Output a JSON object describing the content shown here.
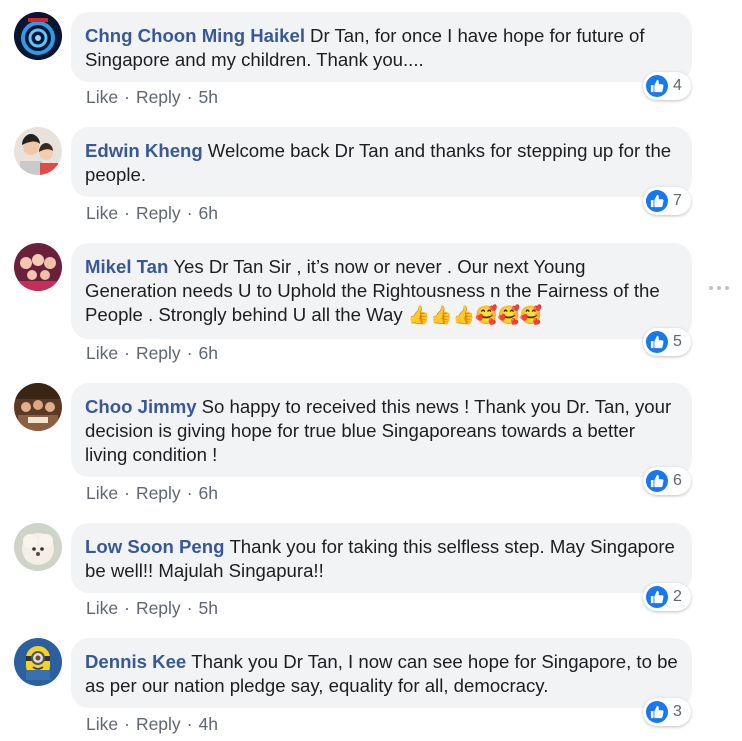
{
  "comments": [
    {
      "author": "Chng Choon Ming Haikel",
      "text": "Dr Tan, for once I have hope for future of Singapore and my children. Thank you....",
      "like": "Like",
      "reply": "Reply",
      "time": "5h",
      "reactions": "4"
    },
    {
      "author": "Edwin Kheng",
      "text": "Welcome back Dr Tan and thanks for stepping up for the people.",
      "like": "Like",
      "reply": "Reply",
      "time": "6h",
      "reactions": "7"
    },
    {
      "author": "Mikel Tan",
      "text": "Yes Dr Tan Sir , it’s now or never . Our next Young Generation needs U to Uphold the Rightousness n the Fairness of the People . Strongly behind U all the Way",
      "emojis": "👍👍👍🥰🥰🥰",
      "like": "Like",
      "reply": "Reply",
      "time": "6h",
      "reactions": "5"
    },
    {
      "author": "Choo Jimmy",
      "text": "So happy to received this news ! Thank you Dr. Tan, your decision is giving hope for true blue Singaporeans towards a better living condition !",
      "like": "Like",
      "reply": "Reply",
      "time": "6h",
      "reactions": "6"
    },
    {
      "author": "Low Soon Peng",
      "text": "Thank you for taking this selfless step. May Singapore be well!! Majulah Singapura!!",
      "like": "Like",
      "reply": "Reply",
      "time": "5h",
      "reactions": "2"
    },
    {
      "author": "Dennis Kee",
      "text": "Thank you Dr Tan, I now can see hope for Singapore, to be as per our nation pledge say, equality for all, democracy.",
      "like": "Like",
      "reply": "Reply",
      "time": "4h",
      "reactions": "3"
    }
  ],
  "separator": "·",
  "icons": {
    "reaction": "like-thumb-icon",
    "options": "more-options-icon"
  },
  "colors": {
    "author": "#385898",
    "like_badge": "#1877f2",
    "bubble": "#f2f3f5"
  }
}
